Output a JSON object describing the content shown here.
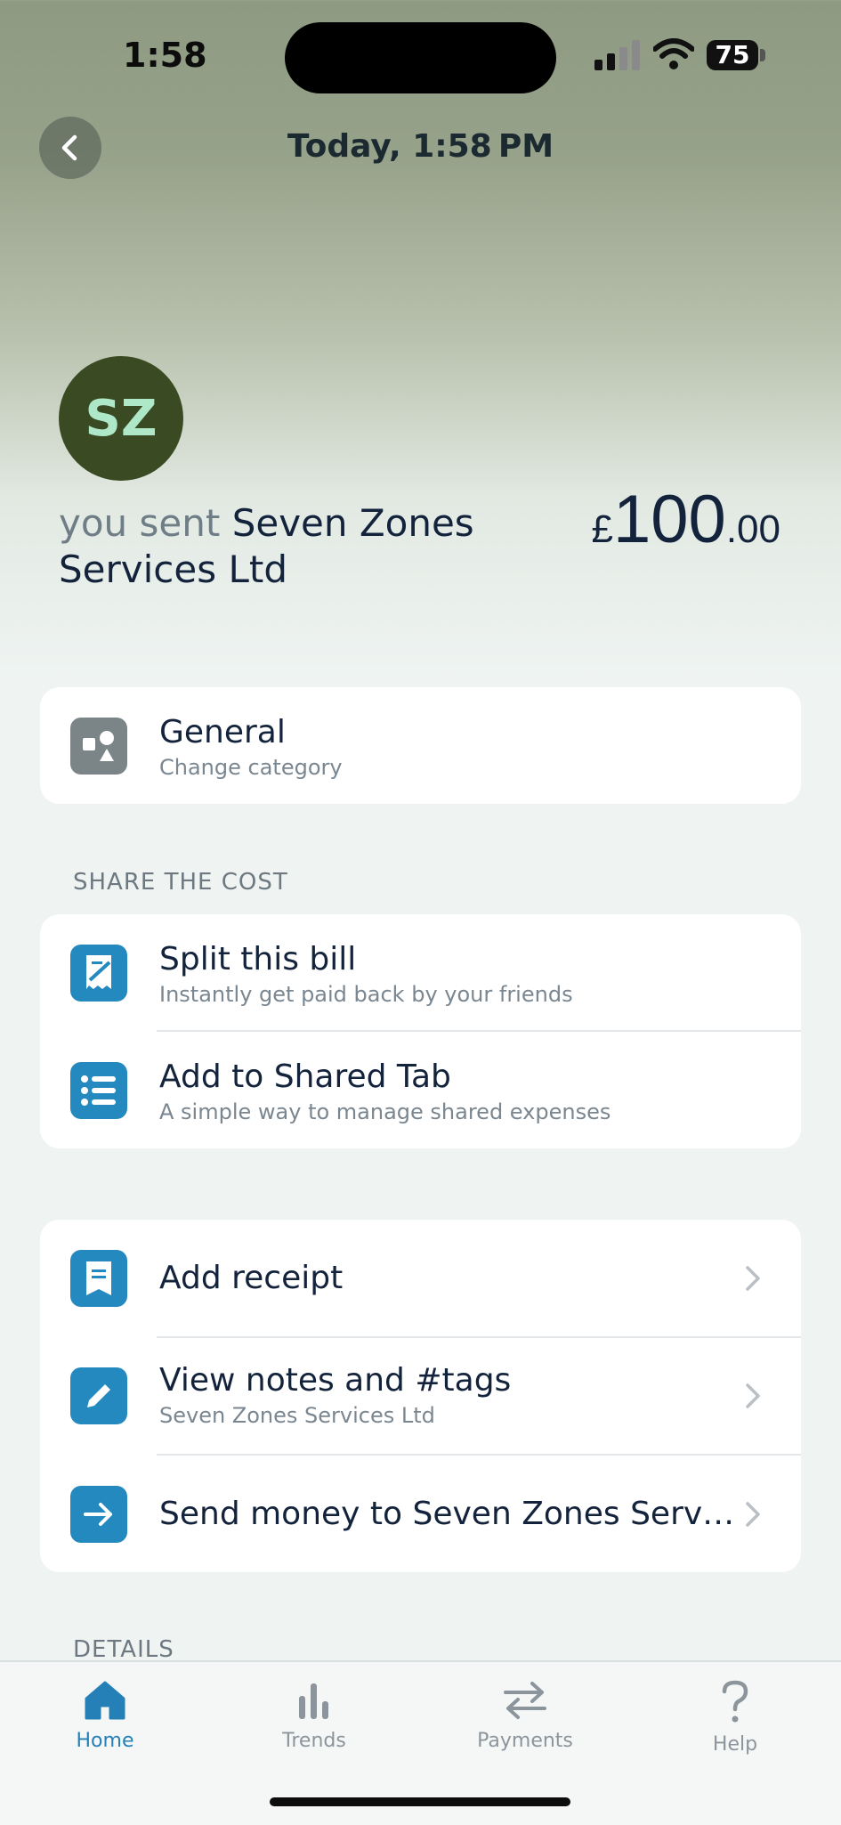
{
  "status_bar": {
    "time": "1:58",
    "battery": "75"
  },
  "nav": {
    "title": "Today, 1:58 PM"
  },
  "transaction": {
    "avatar_initials": "SZ",
    "direction_text": "you sent",
    "payee": "Seven Zones Services Ltd",
    "currency": "£",
    "amount_major": "100",
    "amount_minor": ".00"
  },
  "category": {
    "title": "General",
    "subtitle": "Change category"
  },
  "share_the_cost": {
    "heading": "SHARE THE COST",
    "items": [
      {
        "title": "Split this bill",
        "subtitle": "Instantly get paid back by your friends"
      },
      {
        "title": "Add to Shared Tab",
        "subtitle": "A simple way to manage shared expenses"
      }
    ]
  },
  "actions": {
    "items": [
      {
        "title": "Add receipt",
        "subtitle": ""
      },
      {
        "title": "View notes and #tags",
        "subtitle": "Seven Zones Services Ltd"
      },
      {
        "title": "Send money to Seven Zones Serv…",
        "subtitle": ""
      }
    ]
  },
  "details": {
    "heading": "DETAILS"
  },
  "tabbar": {
    "tabs": [
      {
        "label": "Home",
        "active": true
      },
      {
        "label": "Trends",
        "active": false
      },
      {
        "label": "Payments",
        "active": false
      },
      {
        "label": "Help",
        "active": false
      }
    ]
  },
  "colors": {
    "accent": "#2489bf",
    "avatar_bg": "#3a4a22",
    "avatar_text": "#aee8c8",
    "text": "#14233c"
  }
}
